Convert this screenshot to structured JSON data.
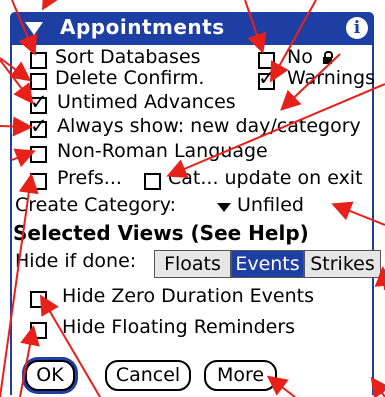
{
  "header": {
    "title": "Appointments",
    "info_glyph": "i"
  },
  "options": {
    "sort_databases": {
      "label": "Sort Databases",
      "checked": false
    },
    "no": {
      "label": "No",
      "checked": false
    },
    "delete_confirm": {
      "label": "Delete Confirm.",
      "checked": false
    },
    "warnings": {
      "label": "Warnings",
      "checked": true
    },
    "untimed_advances": {
      "label": "Untimed Advances",
      "checked": true
    },
    "always_show": {
      "label": "Always show: new day/category",
      "checked": true
    },
    "non_roman": {
      "label": "Non-Roman Language",
      "checked": false
    },
    "prefs": {
      "label": "Prefs...",
      "checked": false
    },
    "cat_update": {
      "label": "Cat... update on exit",
      "checked": false
    }
  },
  "create_category": {
    "label": "Create Category:",
    "value": "Unfiled"
  },
  "views": {
    "title": "Selected Views (See Help)",
    "hide_if_done_label": "Hide if done:",
    "segments": [
      "Floats",
      "Events",
      "Strikes"
    ],
    "active_segment": "Events"
  },
  "hide_options": {
    "zero_duration": {
      "label": "Hide Zero Duration Events",
      "checked": false
    },
    "floating": {
      "label": "Hide Floating Reminders",
      "checked": false
    }
  },
  "buttons": {
    "ok": "OK",
    "cancel": "Cancel",
    "more": "More"
  },
  "colors": {
    "accent": "#1d3ea3",
    "annotation": "#e8201a"
  }
}
